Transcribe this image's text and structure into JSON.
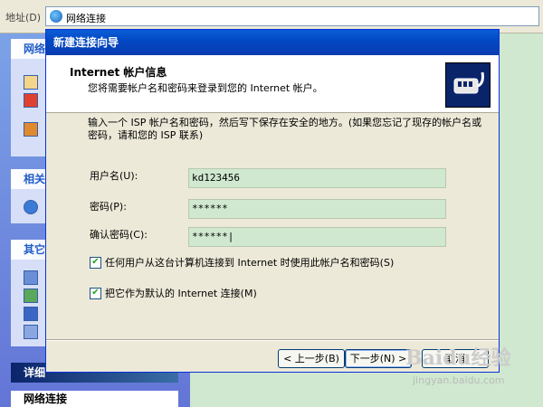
{
  "addressbar": {
    "label": "地址(D)",
    "value": "网络连接"
  },
  "taskpane": {
    "box1_title": "网络",
    "box2_title": "相关",
    "box3_title": "其它",
    "box4_title": "详细",
    "footer_title": "网络连接"
  },
  "dialog": {
    "title": "新建连接向导",
    "header_title": "Internet 帐户信息",
    "header_subtitle": "您将需要帐户名和密码来登录到您的 Internet 帐户。",
    "description": "输入一个 ISP 帐户名和密码，然后写下保存在安全的地方。(如果您忘记了现存的帐户名或密码，请和您的 ISP 联系)",
    "fields": [
      {
        "label": "用户名(U):",
        "value": "kd123456"
      },
      {
        "label": "密码(P):",
        "value": "******"
      },
      {
        "label": "确认密码(C):",
        "value": "******|"
      }
    ],
    "checkboxes": [
      {
        "label": "任何用户从这台计算机连接到 Internet 时使用此帐户名和密码(S)",
        "checked": "✔"
      },
      {
        "label": "把它作为默认的 Internet 连接(M)",
        "checked": "✔"
      }
    ],
    "buttons": {
      "back": "< 上一步(B)",
      "next": "下一步(N) >",
      "cancel": "取消"
    }
  },
  "watermark": {
    "text": "Baidu经验",
    "sub": "jingyan.baidu.com"
  },
  "colors": {
    "titlebar": "#0348c4",
    "field_bg": "#cfe8cf",
    "page_bg": "#cfe8cf"
  }
}
